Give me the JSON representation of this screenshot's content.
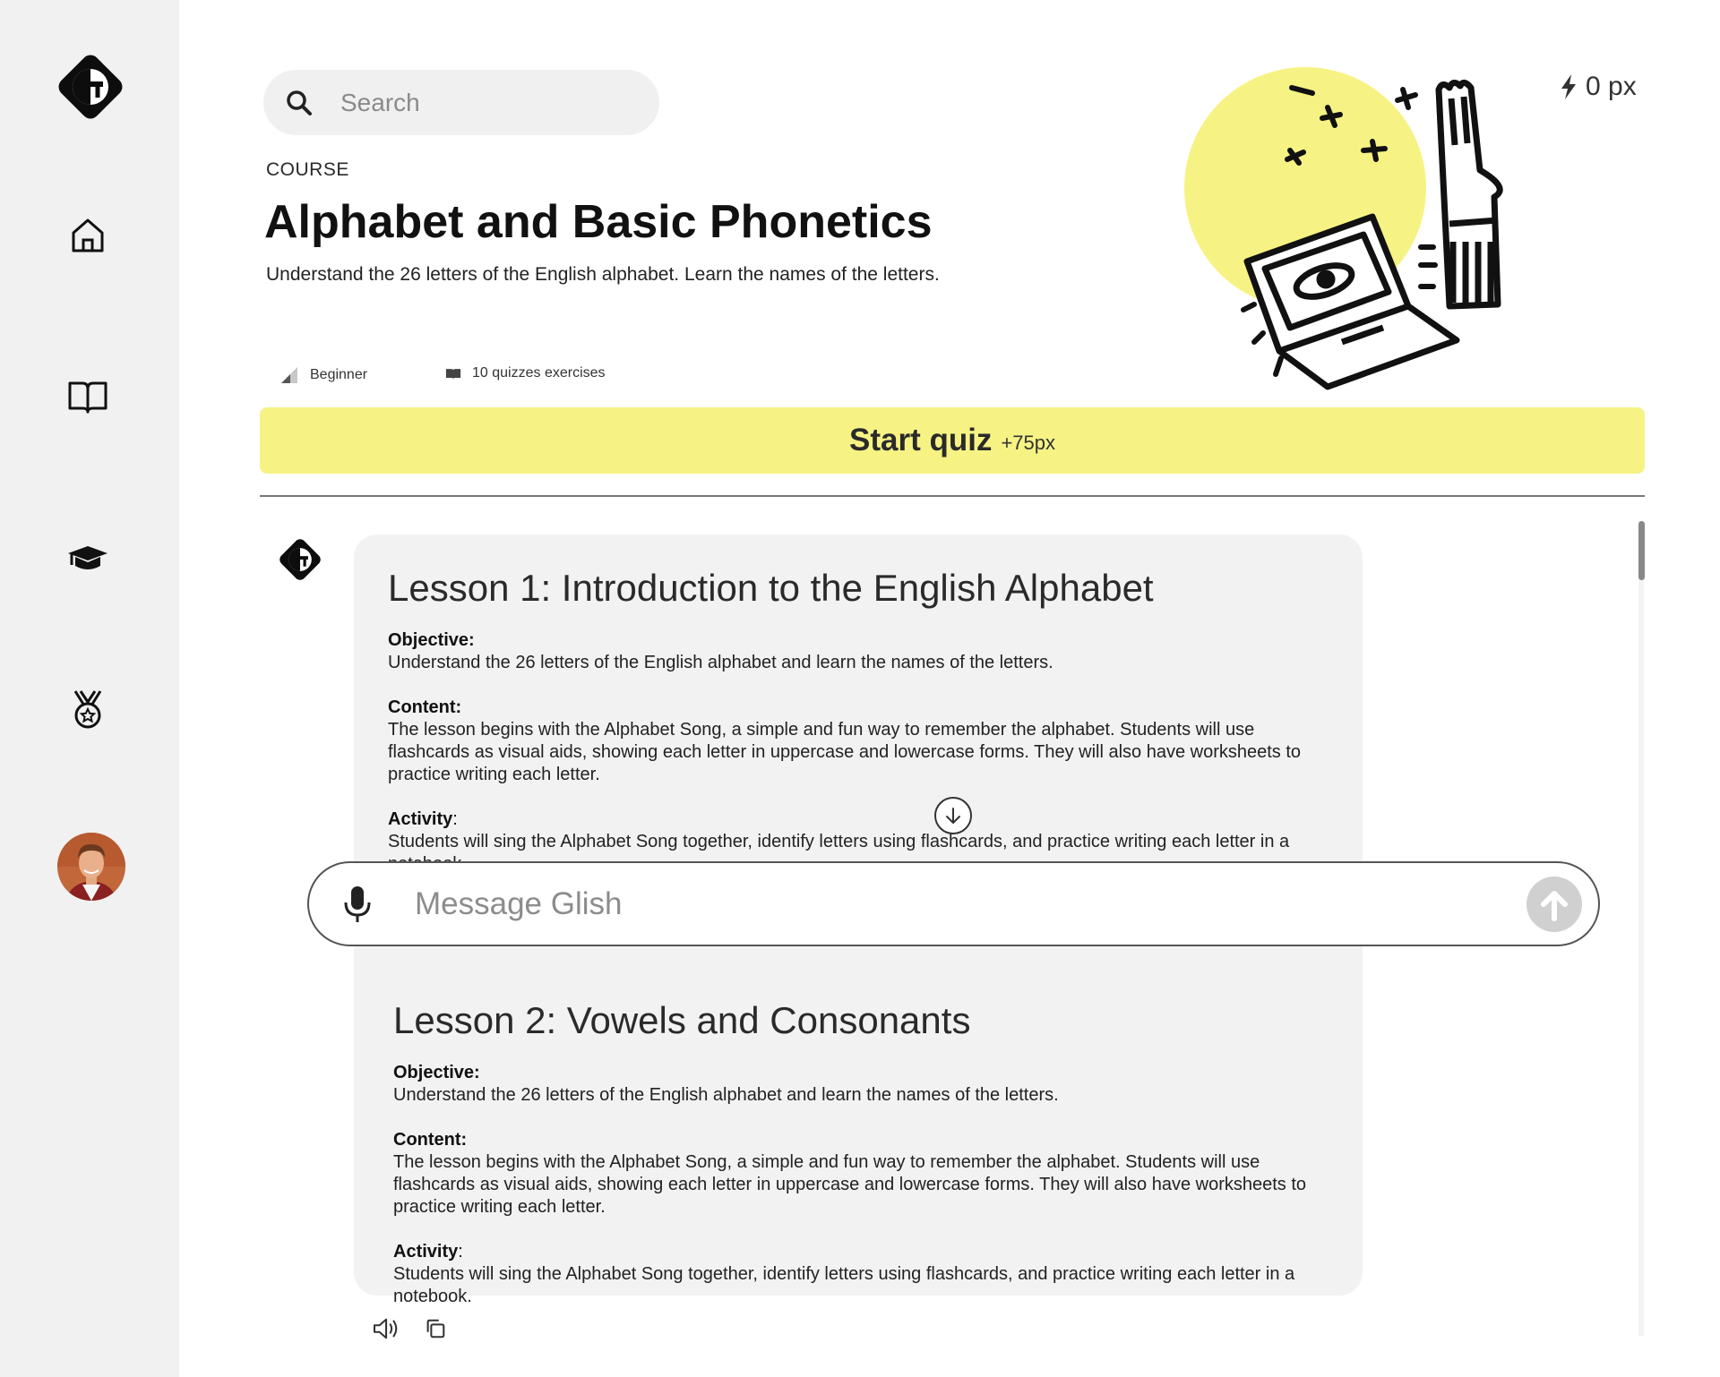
{
  "sidebar": {
    "logo_letter": "G",
    "items": [
      {
        "icon": "home-icon"
      },
      {
        "icon": "book-icon"
      },
      {
        "icon": "graduation-cap-icon"
      },
      {
        "icon": "medal-icon"
      }
    ],
    "avatar": "user-avatar"
  },
  "header": {
    "search_placeholder": "Search",
    "xp_value": "0 px",
    "course_label": "COURSE",
    "title": "Alphabet and Basic Phonetics",
    "description": "Understand the 26 letters of the English alphabet. Learn the names of the letters.",
    "level": "Beginner",
    "exercises": "10 quizzes exercises",
    "start_label": "Start quiz",
    "start_bonus": "+75px"
  },
  "colors": {
    "accent": "#f6f384",
    "sidebar_bg": "#f1f1f1",
    "card_bg": "#f2f2f2"
  },
  "lessons": [
    {
      "title": "Lesson 1: Introduction to the English Alphabet",
      "objective_label": "Objective:",
      "objective": "Understand the 26 letters of the English alphabet and learn the names of the letters.",
      "content_label": "Content:",
      "content": "The lesson begins with the Alphabet Song, a simple and fun way to remember the alphabet. Students will use flashcards as visual aids, showing each letter in uppercase and lowercase forms. They will also have worksheets to practice writing each letter.",
      "activity_label": "Activity",
      "activity": "Students will sing the Alphabet Song together, identify letters using flashcards, and practice writing each letter in a notebook."
    },
    {
      "title": "Lesson 2: Vowels and Consonants",
      "objective_label": "Objective:",
      "objective": "Understand the 26 letters of the English alphabet and learn the names of the letters.",
      "content_label": "Content:",
      "content": "The lesson begins with the Alphabet Song, a simple and fun way to remember the alphabet. Students will use flashcards as visual aids, showing each letter in uppercase and lowercase forms. They will also have worksheets to practice writing each letter.",
      "activity_label": "Activity",
      "activity": "Students will sing the Alphabet Song together, identify letters using flashcards, and practice writing each letter in a notebook."
    }
  ],
  "composer": {
    "placeholder": "Message Glish"
  }
}
